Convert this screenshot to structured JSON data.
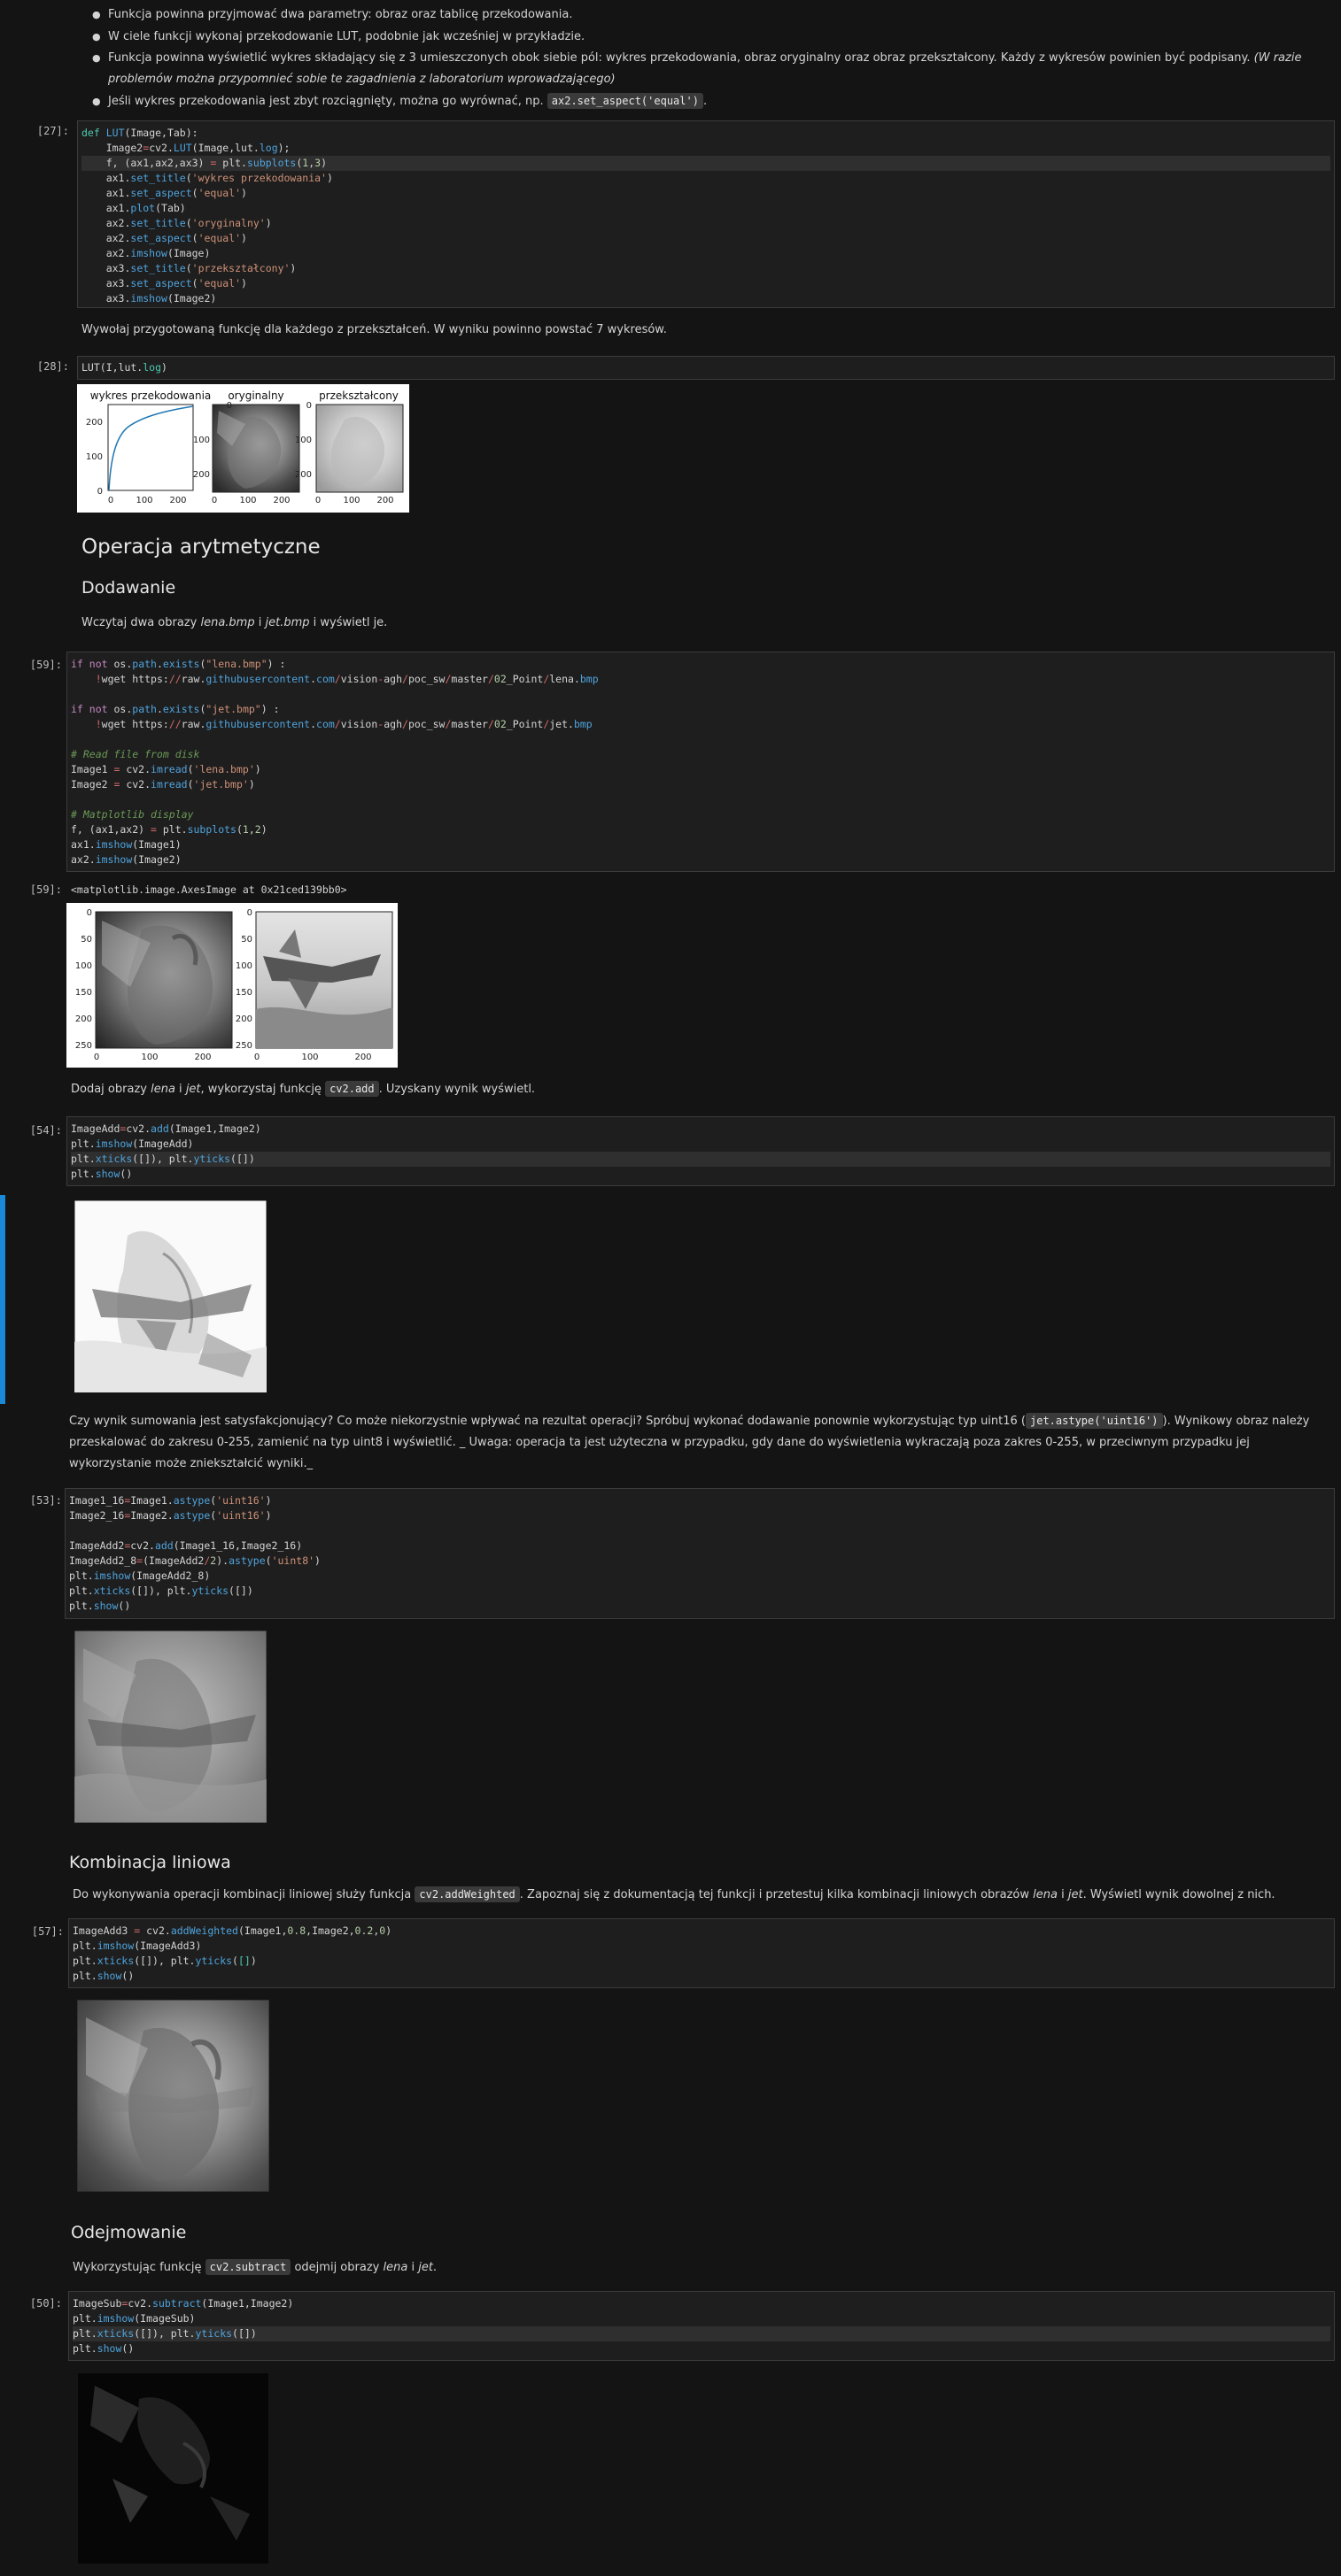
{
  "top_bullets": [
    "Funkcja powinna przyjmować dwa parametry: obraz oraz tablicę przekodowania.",
    "W ciele funkcji wykonaj przekodowanie LUT, podobnie jak wcześniej w przykładzie.",
    "Funkcja powinna wyświetlić wykres składający się z 3 umieszczonych obok siebie pól: wykres przekodowania, obraz oryginalny oraz obraz przekształcony. Każdy z wykresów powinien być podpisany.",
    "(W razie problemów można przypomnieć sobie te zagadnienia z laboratorium wprowadzającego)",
    "Jeśli wykres przekodowania jest zbyt rozciągnięty, można go wyrównać, np.",
    "ax2.set_aspect('equal')",
    "."
  ],
  "cells": {
    "c27": {
      "prompt": "[27]:"
    },
    "c28": {
      "prompt": "[28]:",
      "code": "LUT(I,lut.log)"
    },
    "c59": {
      "prompt": "[59]:",
      "out_prompt": "[59]:",
      "out_text": "<matplotlib.image.AxesImage at 0x21ced139bb0>"
    },
    "c54": {
      "prompt": "[54]:"
    },
    "c53": {
      "prompt": "[53]:"
    },
    "c57": {
      "prompt": "[57]:"
    },
    "c50": {
      "prompt": "[50]:"
    }
  },
  "md": {
    "lut_instr": "Wywołaj przygotowaną funkcję dla każdego z przekształceń. W wyniku powinno powstać 7 wykresów.",
    "h_arith": "Operacja arytmetyczne",
    "h_add": "Dodawanie",
    "load_instr_a": "Wczytaj dwa obrazy ",
    "load_instr_lena": "lena.bmp",
    "load_instr_i": " i ",
    "load_instr_jet": "jet.bmp",
    "load_instr_b": " i wyświetl je.",
    "add_instr_a": "Dodaj obrazy ",
    "add_instr_lena": "lena",
    "add_instr_i": " i ",
    "add_instr_jet": "jet",
    "add_instr_b": ", wykorzystaj funkcję ",
    "add_instr_code": "cv2.add",
    "add_instr_c": ". Uzyskany wynik wyświetl.",
    "q_a": "Czy wynik sumowania jest satysfakcjonujący? Co może niekorzystnie wpływać na rezultat operacji? Spróbuj wykonać dodawanie ponownie wykorzystując typ uint16 (",
    "q_code": "jet.astype('uint16')",
    "q_b": "). Wynikowy obraz należy przeskalować do zakresu 0-255, zamienić na typ uint8 i wyświetlić. _ Uwaga: operacja ta jest użyteczna w przypadku, gdy dane do wyświetlenia wykraczają poza zakres 0-255, w przeciwnym przypadku jej wykorzystanie może zniekształcić wyniki._",
    "h_lin": "Kombinacja liniowa",
    "lin_a": "Do wykonywania operacji kombinacji liniowej służy funkcja ",
    "lin_code": "cv2.addWeighted",
    "lin_b": ". Zapoznaj się z dokumentacją tej funkcji i przetestuj kilka kombinacji liniowych obrazów ",
    "lin_lena": "lena",
    "lin_i": " i ",
    "lin_jet": "jet",
    "lin_c": ". Wyświetl wynik dowolnej z nich.",
    "h_sub": "Odejmowanie",
    "sub_a": "Wykorzystując funkcję ",
    "sub_code": "cv2.subtract",
    "sub_b": " odejmij obrazy ",
    "sub_lena": "lena",
    "sub_i": " i ",
    "sub_jet": "jet",
    "sub_c": "."
  },
  "lut_figure": {
    "titles": [
      "wykres przekodowania",
      "oryginalny",
      "przekształcony"
    ],
    "plot_yticks": [
      "0",
      "100",
      "200"
    ],
    "plot_xticks": [
      "0",
      "100",
      "200"
    ],
    "img_yticks": [
      "0",
      "100",
      "200"
    ],
    "img_xticks": [
      "0",
      "100",
      "200"
    ]
  },
  "load_figure": {
    "yticks": [
      "0",
      "50",
      "100",
      "150",
      "200",
      "250"
    ],
    "xticks": [
      "0",
      "100",
      "200"
    ]
  },
  "colors": {
    "accent": "#1a8ad8",
    "curve": "#1f77b4"
  }
}
